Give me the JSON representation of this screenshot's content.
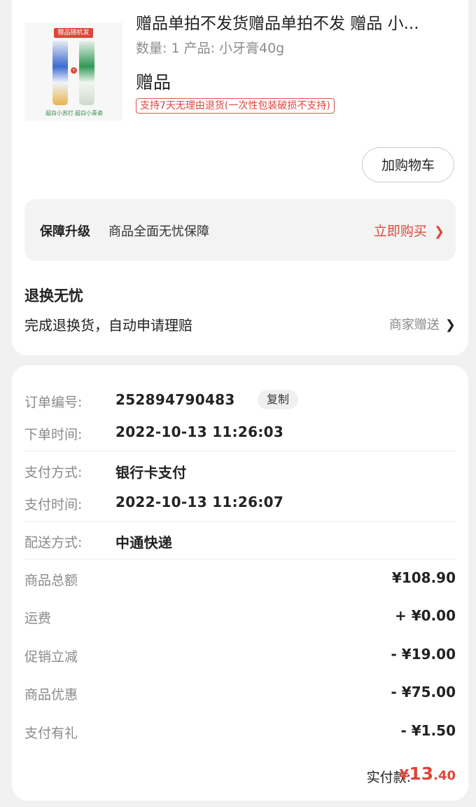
{
  "product": {
    "image": {
      "sticker": "赠品随机发",
      "label_left": "超白小苏打",
      "label_right": "超白小青瓷"
    },
    "title": "赠品单拍不发货赠品单拍不发 赠品 小...",
    "meta": "数量: 1  产品: 小牙膏40g",
    "gift_label": "赠品",
    "return_policy": "支持7天无理由退货(一次性包装破损不支持)",
    "add_to_cart": "加购物车"
  },
  "guarantee": {
    "title": "保障升级",
    "desc": "商品全面无忧保障",
    "action": "立即购买"
  },
  "worry_free": {
    "title": "退换无忧",
    "desc": "完成退换货，自动申请理赔",
    "right": "商家赠送"
  },
  "order": {
    "number_label": "订单编号:",
    "number": "252894790483",
    "copy_label": "复制",
    "order_time_label": "下单时间:",
    "order_time": "2022-10-13 11:26:03",
    "pay_method_label": "支付方式:",
    "pay_method": "银行卡支付",
    "pay_time_label": "支付时间:",
    "pay_time": "2022-10-13 11:26:07",
    "delivery_label": "配送方式:",
    "delivery": "中通快递"
  },
  "amounts": {
    "total_label": "商品总额",
    "total": "¥108.90",
    "shipping_label": "运费",
    "shipping": "+ ¥0.00",
    "promo_label": "促销立减",
    "promo": "- ¥19.00",
    "discount_label": "商品优惠",
    "discount": "- ¥75.00",
    "gift_label": "支付有礼",
    "gift": "- ¥1.50",
    "paid_label": "实付款:",
    "paid_currency": "¥",
    "paid_int": "13",
    "paid_dec": ".40"
  },
  "colors": {
    "accent": "#e0453a",
    "background": "#f1f1f1"
  }
}
